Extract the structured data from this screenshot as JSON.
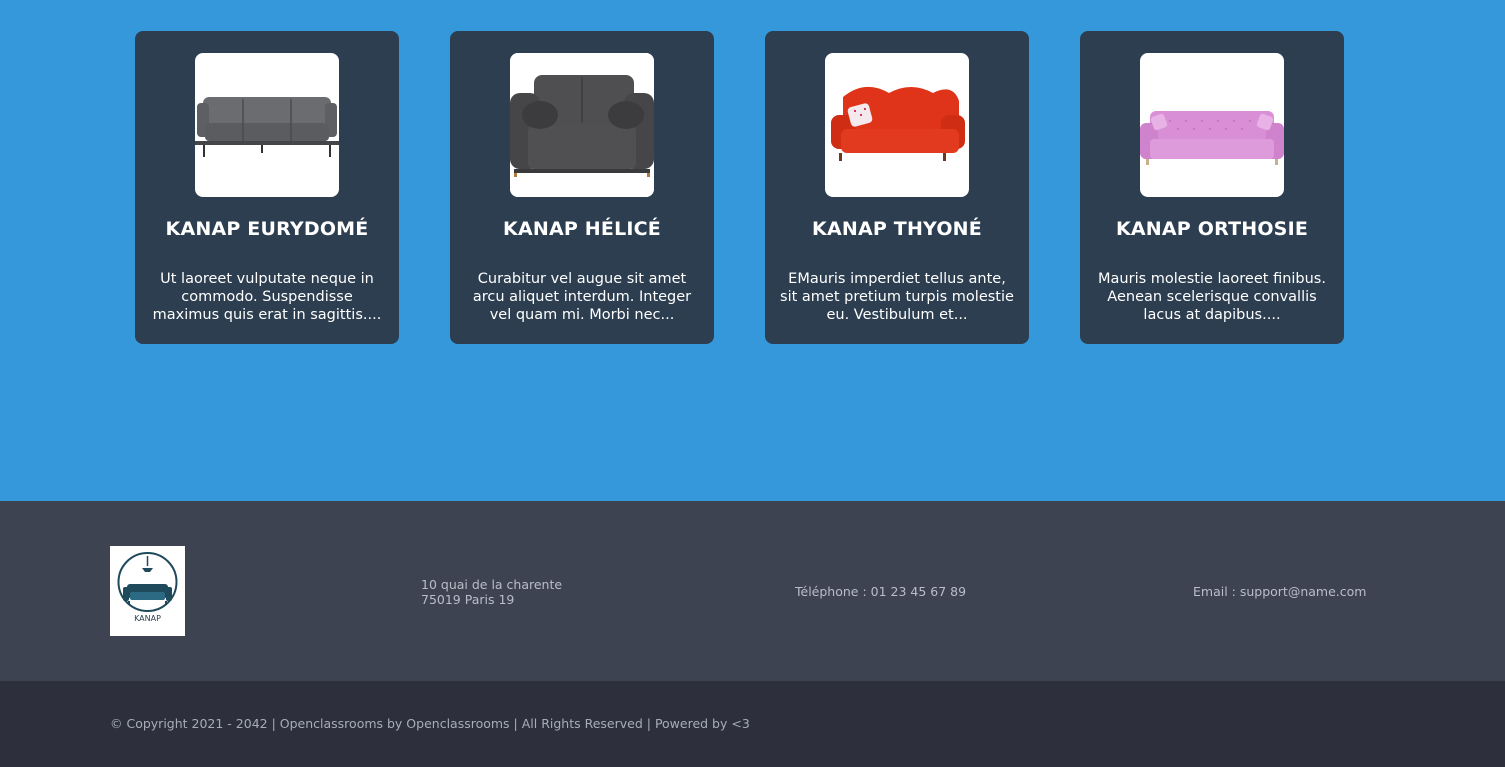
{
  "products": [
    {
      "name": "KANAP EURYDOMÉ",
      "description": "Ut laoreet vulputate neque in commodo. Suspendisse maximus quis erat in sagittis....",
      "image_icon": "grey-sofa-icon",
      "sofa_color": "#5b5c60"
    },
    {
      "name": "KANAP HÉLICÉ",
      "description": "Curabitur vel augue sit amet arcu aliquet interdum. Integer vel quam mi. Morbi nec...",
      "image_icon": "dark-grey-loveseat-icon",
      "sofa_color": "#4a4a4c"
    },
    {
      "name": "KANAP THYONÉ",
      "description": "EMauris imperdiet tellus ante, sit amet pretium turpis molestie eu. Vestibulum et...",
      "image_icon": "red-sofa-icon",
      "sofa_color": "#e0341a"
    },
    {
      "name": "KANAP ORTHOSIE",
      "description": "Mauris molestie laoreet finibus. Aenean scelerisque convallis lacus at dapibus....",
      "image_icon": "pink-sofa-icon",
      "sofa_color": "#d98fd6"
    }
  ],
  "footer": {
    "logo_text": "KANAP",
    "address_line1": "10 quai de la charente",
    "address_line2": "75019 Paris 19",
    "phone": "Téléphone : 01 23 45 67 89",
    "email": "Email : support@name.com",
    "copyright": "© Copyright 2021 - 2042 | Openclassrooms by Openclassrooms | All Rights Reserved | Powered by <3"
  },
  "colors": {
    "page_background": "#3498db",
    "card_background": "#2c3e50",
    "footer_top": "#3d4350",
    "footer_bottom": "#2d2f3d"
  }
}
